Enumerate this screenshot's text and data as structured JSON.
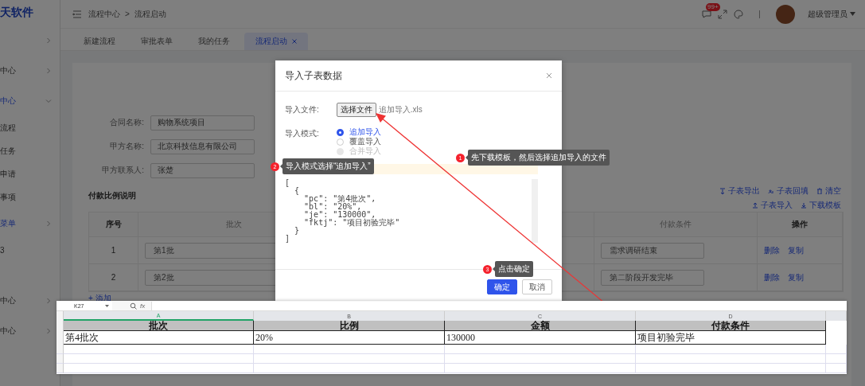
{
  "sidebar": {
    "logo": "天软件",
    "items": [
      {
        "kind": "group",
        "expanded": false
      },
      {
        "kind": "group",
        "label": "中心",
        "expanded": false,
        "active": false
      },
      {
        "kind": "group",
        "label": "中心",
        "expanded": true,
        "active": true
      },
      {
        "kind": "sub",
        "label": "流程",
        "active": false
      },
      {
        "kind": "sub",
        "label": "任务",
        "active": false
      },
      {
        "kind": "sub",
        "label": "申请",
        "active": false
      },
      {
        "kind": "sub",
        "label": "事项",
        "active": false
      },
      {
        "kind": "group",
        "label": "菜单",
        "expanded": false,
        "active": true
      },
      {
        "kind": "sub",
        "label": "3",
        "active": false
      },
      {
        "kind": "gap"
      },
      {
        "kind": "group",
        "label": "中心",
        "expanded": false,
        "active": false
      },
      {
        "kind": "group",
        "label": "中心",
        "expanded": false,
        "active": false
      }
    ]
  },
  "header": {
    "breadcrumb": [
      "流程中心",
      "流程启动"
    ],
    "separator": ">",
    "message_badge": "99+",
    "user": "超级管理员"
  },
  "tabs": [
    {
      "label": "新建流程",
      "selected": false
    },
    {
      "label": "审批表单",
      "selected": false
    },
    {
      "label": "我的任务",
      "selected": false
    },
    {
      "label": "流程启动",
      "selected": true
    }
  ],
  "form": {
    "fields": [
      {
        "label": "合同名称:",
        "value": "购物系统项目"
      },
      {
        "label": "甲方名称:",
        "value": "北京科技信息有限公司"
      },
      {
        "label": "甲方联系人:",
        "value": "张楚"
      }
    ]
  },
  "subtable": {
    "title": "付款比例说明",
    "actions_top": [
      "子表导出",
      "子表回填",
      "清空"
    ],
    "actions_bottom": [
      "子表导入",
      "下载模板"
    ],
    "columns": [
      "序号",
      "批次",
      "付款条件",
      "操作"
    ],
    "rows": [
      {
        "index": "1",
        "batch": "第1批",
        "condition": "需求调研结束",
        "actions": [
          "删除",
          "复制"
        ]
      },
      {
        "index": "2",
        "batch": "第2批",
        "condition": "第二阶段开发完毕",
        "actions": [
          "删除",
          "复制"
        ]
      }
    ],
    "add": "+ 添加"
  },
  "dialog": {
    "title": "导入子表数据",
    "file_label": "导入文件:",
    "file_button": "选择文件",
    "file_name": "追加导入.xls",
    "mode_label": "导入模式:",
    "modes": [
      {
        "label": "追加导入",
        "selected": true,
        "disabled": false
      },
      {
        "label": "覆盖导入",
        "selected": false,
        "disabled": false
      },
      {
        "label": "合并导入",
        "selected": false,
        "disabled": true
      }
    ],
    "json_text": "[\n  {\n    \"pc\": \"第4批次\",\n    \"bl\": \"20%\",\n    \"je\": \"130000\",\n    \"fktj\": \"项目初验完毕\"\n  }\n]",
    "buttons": [
      {
        "label": "确定",
        "kind": "primary"
      },
      {
        "label": "取消",
        "kind": "default"
      }
    ]
  },
  "tips": [
    {
      "number": "1",
      "text": "先下载模板，然后选择追加导入的文件"
    },
    {
      "number": "2",
      "text": "导入模式选择“追加导入”"
    },
    {
      "number": "3",
      "text": "点击确定"
    }
  ],
  "spreadsheet": {
    "cell_ref": "K27",
    "formula_icon": "fx",
    "columns": [
      {
        "letter": "A",
        "selected": true
      },
      {
        "letter": "B",
        "selected": false
      },
      {
        "letter": "C",
        "selected": false
      },
      {
        "letter": "D",
        "selected": false
      }
    ],
    "header": [
      "批次",
      "比例",
      "金额",
      "付款条件"
    ],
    "rows": [
      [
        "第4批次",
        "20%",
        "130000",
        "项目初验完毕"
      ]
    ]
  }
}
